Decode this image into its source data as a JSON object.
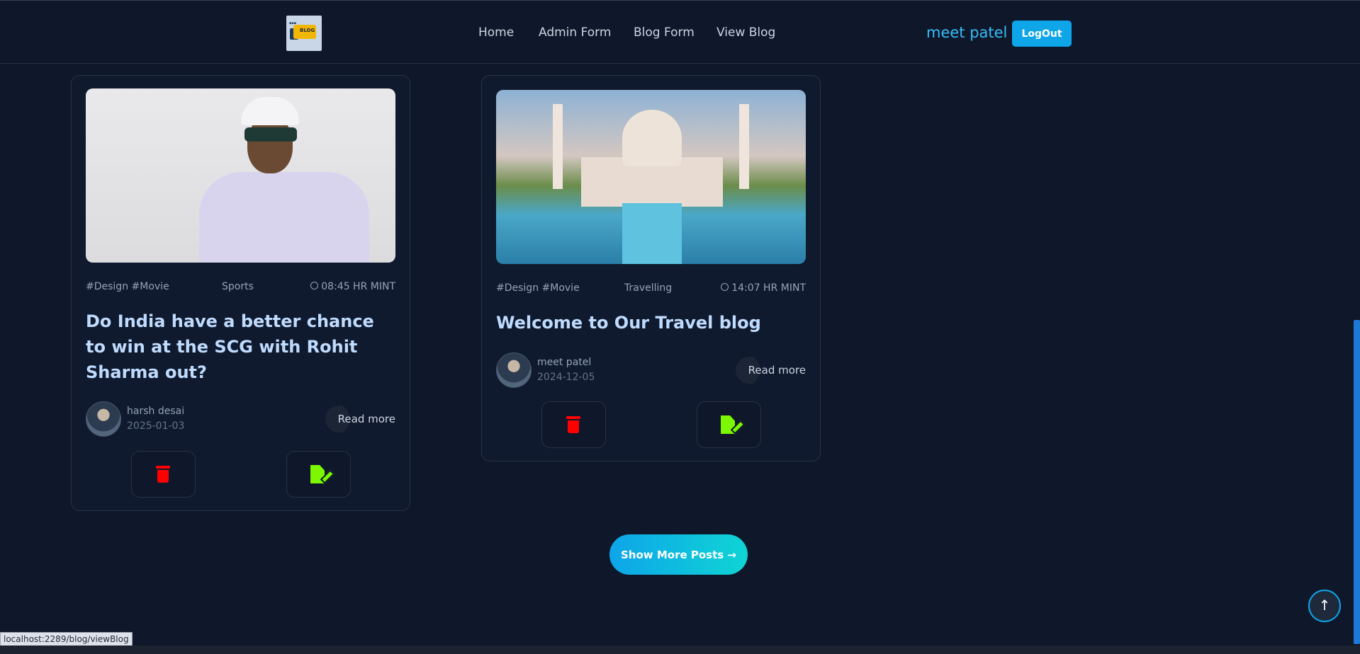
{
  "header": {
    "logo_text": "BLOG",
    "nav": [
      "Home",
      "Admin Form",
      "Blog Form",
      "View Blog"
    ],
    "username": "meet patel",
    "logout_label": "LogOut"
  },
  "posts": [
    {
      "tags": "#Design #Movie",
      "category": "Sports",
      "time": "08:45 HR MINT",
      "title": "Do India have a better chance to win at the SCG with Rohit Sharma out?",
      "author": "harsh desai",
      "date": "2025-01-03",
      "read_more": "Read more"
    },
    {
      "tags": "#Design #Movie",
      "category": "Travelling",
      "time": "14:07 HR MINT",
      "title": "Welcome to Our Travel blog",
      "author": "meet patel",
      "date": "2024-12-05",
      "read_more": "Read more"
    }
  ],
  "show_more_label": "Show More Posts →",
  "scroll_top_icon": "↑",
  "status_url": "localhost:2289/blog/viewBlog",
  "colors": {
    "background": "#0f172a",
    "accent": "#0ea5e9",
    "delete": "#ff0000",
    "edit": "#7cf900",
    "title": "#bfdbfe"
  }
}
